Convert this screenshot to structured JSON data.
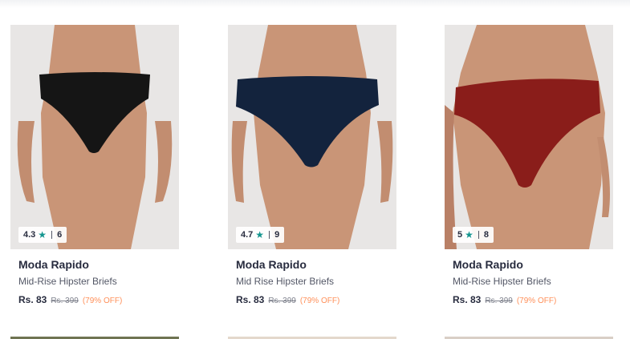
{
  "products": [
    {
      "brand": "Moda Rapido",
      "name": "Mid-Rise Hipster Briefs",
      "rating": "4.3",
      "rating_count": "6",
      "price": "Rs. 83",
      "mrp": "Rs. 399",
      "discount": "(79% OFF)",
      "garment_color": "#151515"
    },
    {
      "brand": "Moda Rapido",
      "name": "Mid Rise Hipster Briefs",
      "rating": "4.7",
      "rating_count": "9",
      "price": "Rs. 83",
      "mrp": "Rs. 399",
      "discount": "(79% OFF)",
      "garment_color": "#13233d"
    },
    {
      "brand": "Moda Rapido",
      "name": "Mid-Rise Hipster Briefs",
      "rating": "5",
      "rating_count": "8",
      "price": "Rs. 83",
      "mrp": "Rs. 399",
      "discount": "(79% OFF)",
      "garment_color": "#8a1d1a"
    }
  ],
  "next_row_colors": [
    "#6f7452",
    "#e4d8cc",
    "#d9cfc6"
  ],
  "colors": {
    "accent_star": "#14958f",
    "discount": "#ff905a",
    "skin": "#c99577"
  }
}
